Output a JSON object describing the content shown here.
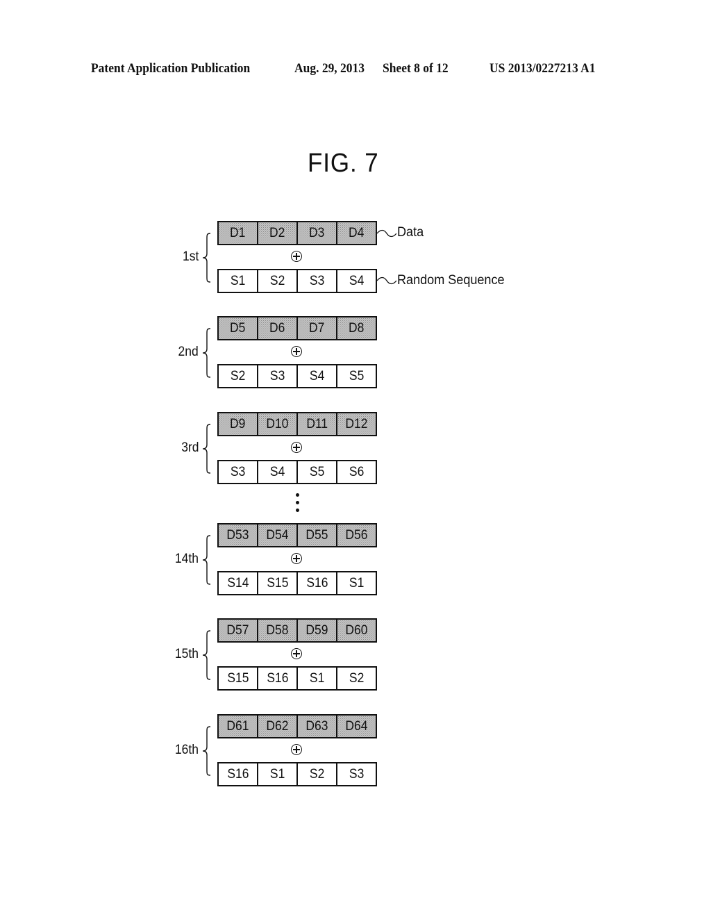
{
  "header": {
    "publication": "Patent Application Publication",
    "date": "Aug. 29, 2013",
    "sheet": "Sheet 8 of 12",
    "number": "US 2013/0227213 A1"
  },
  "figure": {
    "title": "FIG. 7",
    "callouts": {
      "data": "Data",
      "sequence": "Random Sequence"
    },
    "operator_icon": "xor-circled-plus-icon",
    "ellipsis_icon": "vertical-ellipsis-icon",
    "groups": [
      {
        "label": "1st",
        "data": [
          "D1",
          "D2",
          "D3",
          "D4"
        ],
        "sequence": [
          "S1",
          "S2",
          "S3",
          "S4"
        ]
      },
      {
        "label": "2nd",
        "data": [
          "D5",
          "D6",
          "D7",
          "D8"
        ],
        "sequence": [
          "S2",
          "S3",
          "S4",
          "S5"
        ]
      },
      {
        "label": "3rd",
        "data": [
          "D9",
          "D10",
          "D11",
          "D12"
        ],
        "sequence": [
          "S3",
          "S4",
          "S5",
          "S6"
        ]
      },
      {
        "label": "14th",
        "data": [
          "D53",
          "D54",
          "D55",
          "D56"
        ],
        "sequence": [
          "S14",
          "S15",
          "S16",
          "S1"
        ]
      },
      {
        "label": "15th",
        "data": [
          "D57",
          "D58",
          "D59",
          "D60"
        ],
        "sequence": [
          "S15",
          "S16",
          "S1",
          "S2"
        ]
      },
      {
        "label": "16th",
        "data": [
          "D61",
          "D62",
          "D63",
          "D64"
        ],
        "sequence": [
          "S16",
          "S1",
          "S2",
          "S3"
        ]
      }
    ]
  }
}
